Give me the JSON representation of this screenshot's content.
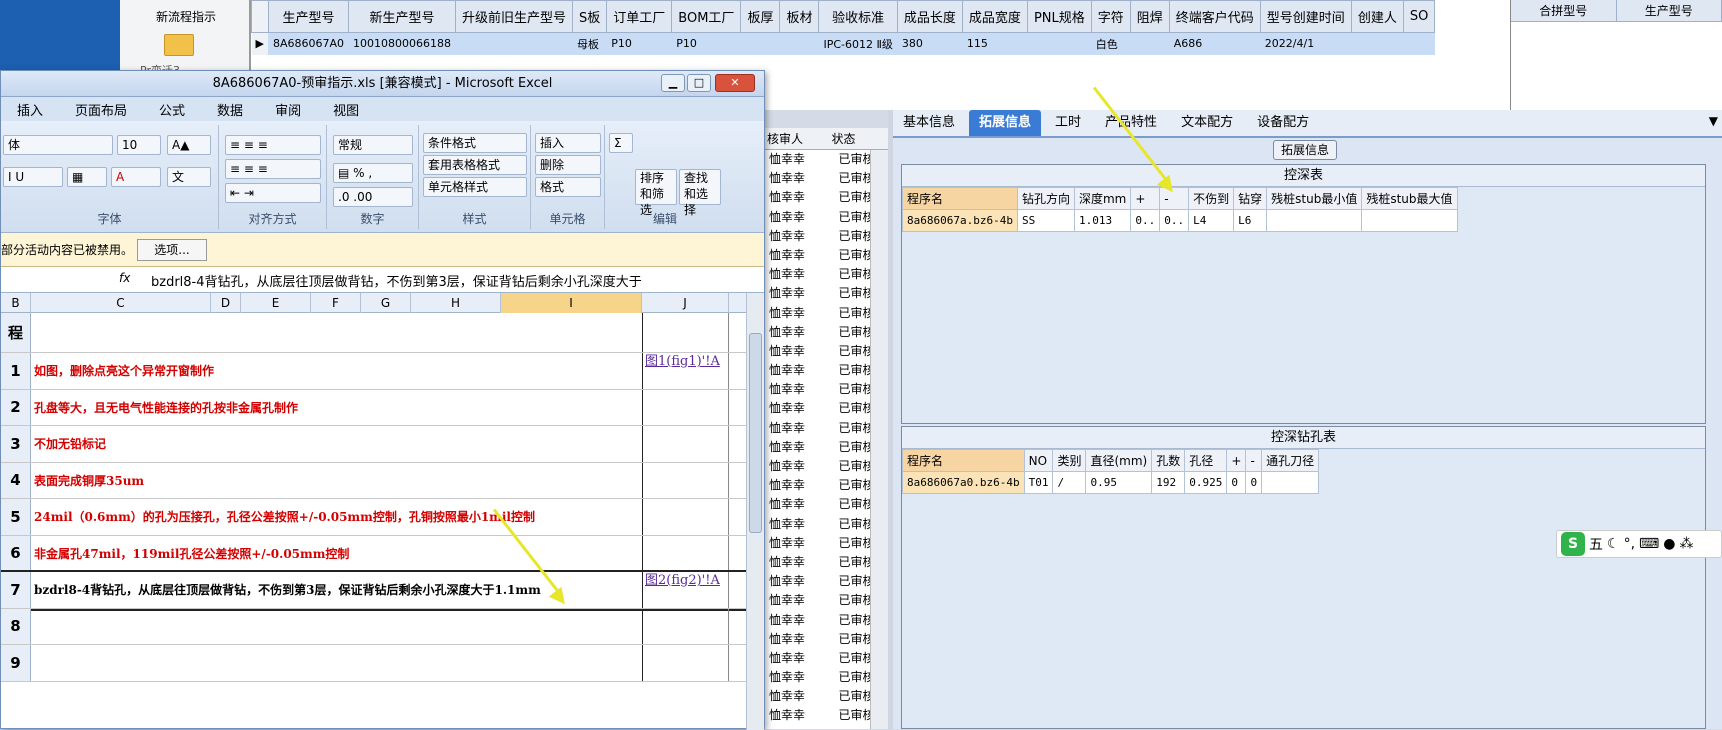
{
  "launcher": {
    "label": "新流程指示",
    "label2": "Pr变迁3"
  },
  "top_grid": {
    "columns": [
      "生产型号",
      "新生产型号",
      "升级前旧生产型号",
      "S板",
      "订单工厂",
      "BOM工厂",
      "板厚",
      "板材",
      "验收标准",
      "成品长度",
      "成品宽度",
      "PNL规格",
      "字符",
      "阻焊",
      "终端客户代码",
      "型号创建时间",
      "创建人",
      "SO"
    ],
    "row": [
      "8A686067A0",
      "10010800066188",
      "",
      "母板",
      "P10",
      "P10",
      "",
      "",
      "IPC-6012 Ⅱ级",
      "380",
      "115",
      "",
      "白色",
      "",
      "A686",
      "2022/4/1",
      "",
      ""
    ]
  },
  "merge_panel": {
    "columns": [
      "合拼型号",
      "生产型号"
    ]
  },
  "mid_list": {
    "columns": [
      "核审人",
      "状态"
    ],
    "rows": [
      [
        "恤幸幸",
        "已审核"
      ],
      [
        "恤幸幸",
        "已审核"
      ],
      [
        "恤幸幸",
        "已审核"
      ],
      [
        "恤幸幸",
        "已审核"
      ],
      [
        "恤幸幸",
        "已审核"
      ],
      [
        "恤幸幸",
        "已审核"
      ],
      [
        "恤幸幸",
        "已审核"
      ],
      [
        "恤幸幸",
        "已审核"
      ],
      [
        "恤幸幸",
        "已审核"
      ],
      [
        "恤幸幸",
        "已审核"
      ],
      [
        "恤幸幸",
        "已审核"
      ],
      [
        "恤幸幸",
        "已审核"
      ],
      [
        "恤幸幸",
        "已审核"
      ],
      [
        "恤幸幸",
        "已审核"
      ],
      [
        "恤幸幸",
        "已审核"
      ],
      [
        "恤幸幸",
        "已审核"
      ],
      [
        "恤幸幸",
        "已审核"
      ],
      [
        "恤幸幸",
        "已审核"
      ],
      [
        "恤幸幸",
        "已审核"
      ],
      [
        "恤幸幸",
        "已审核"
      ],
      [
        "恤幸幸",
        "已审核"
      ],
      [
        "恤幸幸",
        "已审核"
      ],
      [
        "恤幸幸",
        "已审核"
      ],
      [
        "恤幸幸",
        "已审核"
      ],
      [
        "恤幸幸",
        "已审核"
      ],
      [
        "恤幸幸",
        "已审核"
      ],
      [
        "恤幸幸",
        "已审核"
      ],
      [
        "恤幸幸",
        "已审核"
      ],
      [
        "恤幸幸",
        "已审核"
      ],
      [
        "恤幸幸",
        "已审核"
      ]
    ]
  },
  "right_panel": {
    "tabs": [
      "基本信息",
      "拓展信息",
      "工时",
      "产品特性",
      "文本配方",
      "设备配方"
    ],
    "active_tab": "拓展信息",
    "ext_button": "拓展信息",
    "depth_table": {
      "title": "控深表",
      "columns": [
        "程序名",
        "钻孔方向",
        "深度mm",
        "+",
        "-",
        "不伤到",
        "钻穿",
        "残桩stub最小值",
        "残桩stub最大值"
      ],
      "row": [
        "8a686067a.bz6-4b",
        "SS",
        "1.013",
        "0..",
        "0..",
        "L4",
        "L6",
        "",
        ""
      ]
    },
    "hole_table": {
      "title": "控深钻孔表",
      "columns": [
        "程序名",
        "NO",
        "类别",
        "直径(mm)",
        "孔数",
        "孔径",
        "+",
        "-",
        "通孔刀径"
      ],
      "row": [
        "8a686067a0.bz6-4b",
        "T01",
        "/",
        "0.95",
        "192",
        "0.925",
        "0",
        "0",
        ""
      ]
    }
  },
  "ime": {
    "label": "五"
  },
  "excel": {
    "title": "8A686067A0-预审指示.xls [兼容模式] - Microsoft Excel",
    "menu": [
      "插入",
      "页面布局",
      "公式",
      "数据",
      "审阅",
      "视图"
    ],
    "ribbon": {
      "font_name": "体",
      "font_size": "10",
      "number_format": "常规",
      "groups": [
        "字体",
        "对齐方式",
        "数字",
        "样式",
        "单元格",
        "编辑"
      ],
      "style_buttons": [
        "条件格式",
        "套用表格格式",
        "单元格样式"
      ],
      "cell_buttons": [
        "插入",
        "删除",
        "格式"
      ],
      "edit_buttons": [
        "排序和筛选",
        "查找和选择"
      ]
    },
    "security_msg": "部分活动内容已被禁用。",
    "options_btn": "选项...",
    "fx": "fx",
    "formula": "bzdrl8-4背钻孔，从底层往顶层做背钻，不伤到第3层，保证背钻后剩余小孔深度大于",
    "columns": [
      "B",
      "C",
      "D",
      "E",
      "F",
      "G",
      "H",
      "I",
      "J"
    ],
    "header_cell": "程",
    "rows": [
      {
        "n": "1",
        "text": "如图，删除点亮这个异常开窗制作",
        "link": "图1(fig1)'!A"
      },
      {
        "n": "2",
        "text": "孔盘等大，且无电气性能连接的孔按非金属孔制作",
        "link": ""
      },
      {
        "n": "3",
        "text": "不加无铅标记",
        "link": ""
      },
      {
        "n": "4",
        "text": "表面完成铜厚35um",
        "link": ""
      },
      {
        "n": "5",
        "text": "24mil（0.6mm）的孔为压接孔，孔径公差按照+/-0.05mm控制，孔铜按照最小1mil控制",
        "link": ""
      },
      {
        "n": "6",
        "text": "非金属孔47mil，119mil孔径公差按照+/-0.05mm控制",
        "link": ""
      },
      {
        "n": "7",
        "text": "bzdrl8-4背钻孔，从底层往顶层做背钻，不伤到第3层，保证背钻后剩余小孔深度大于1.1mm",
        "link": "图2(fig2)'!A"
      },
      {
        "n": "8",
        "text": "",
        "link": ""
      },
      {
        "n": "9",
        "text": "",
        "link": ""
      }
    ]
  }
}
